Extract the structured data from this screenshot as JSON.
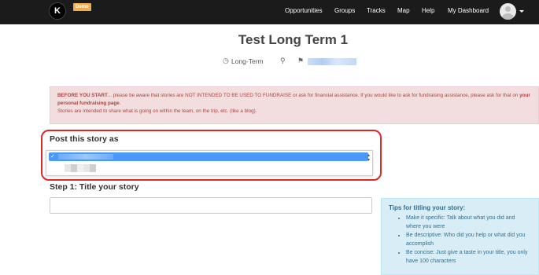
{
  "header": {
    "logo_letter": "K",
    "badge": "Demo",
    "nav": [
      "Opportunities",
      "Groups",
      "Tracks",
      "Map",
      "Help",
      "My Dashboard"
    ]
  },
  "trip": {
    "title": "Test Long Term 1",
    "type": "Long-Term"
  },
  "alert": {
    "lead": "BEFORE YOU START",
    "text1": "... please be aware that stories are NOT INTENDED TO BE USED TO FUNDRAISE or ask for financial assistance. If you would like to ask for fundraising assistance, please ask for that on ",
    "link": "your personal fundraising page",
    "text2": ".",
    "line2": "Stories are intended to share what is going on within the team, on the trip, etc. (like a blog)."
  },
  "form": {
    "post_as_label": "Post this story as",
    "step1_label": "Step 1: Title your story",
    "check": "✓"
  },
  "tips": {
    "title": "Tips for titling your story:",
    "items": [
      "Make it specific: Talk about what you did and where you were",
      "Be descriptive: Who did you help or what did you accomplish",
      "Be concise: Just give a taste in your title, you only have 100 characters"
    ]
  },
  "colors": {
    "topbar": "#1b1b1b",
    "alert_bg": "#f2dede",
    "selection": "#4a98f7",
    "highlight": "#e0262a",
    "tips_bg": "#d9edf7"
  }
}
